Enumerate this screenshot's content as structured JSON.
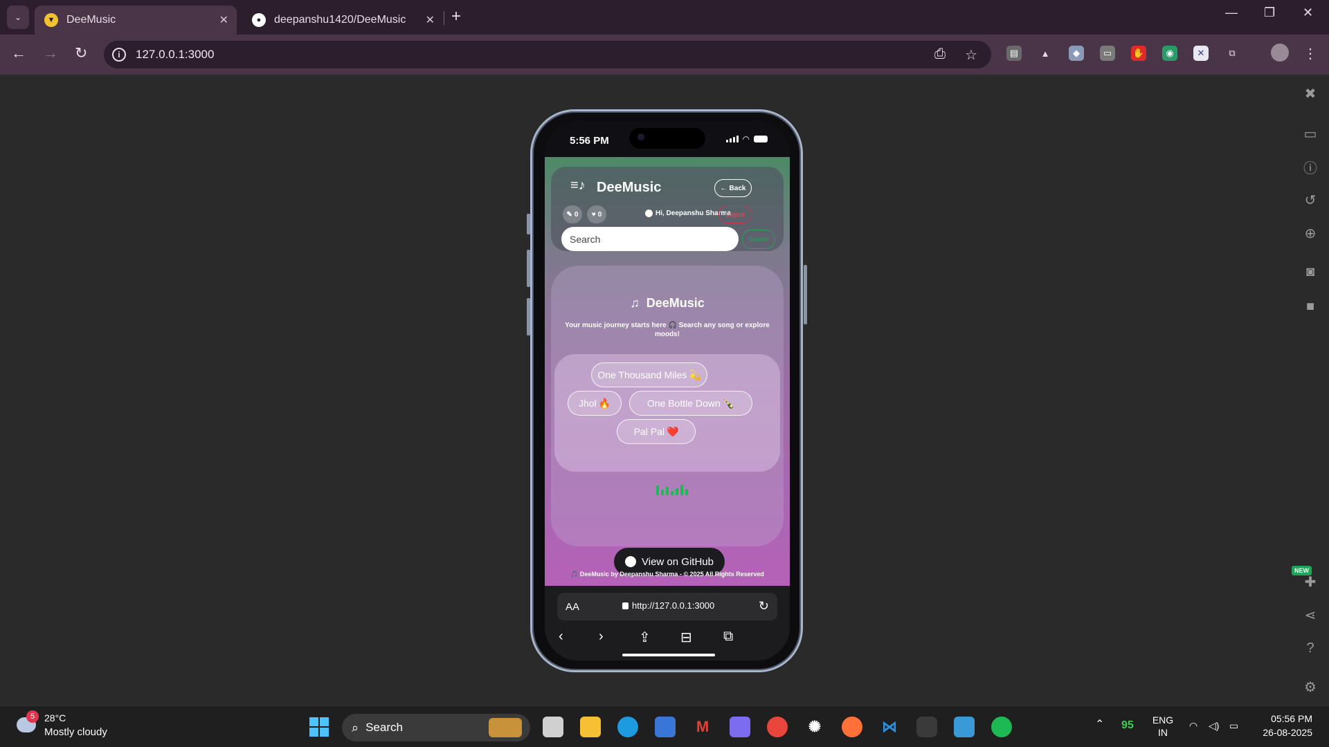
{
  "browser": {
    "tabs": [
      {
        "label": "DeeMusic",
        "active": true
      },
      {
        "label": "deepanshu1420/DeeMusic",
        "active": false
      }
    ],
    "url": "127.0.0.1:3000"
  },
  "phone": {
    "status_time": "5:56 PM",
    "app": {
      "brand": "DeeMusic",
      "back_label": "Back",
      "playlist_count": "0",
      "liked_count": "0",
      "greeting": "Hi, Deepanshu Sharma",
      "logout_label": "Logout",
      "search_placeholder": "Search",
      "search_button": "Search",
      "hero_title": "DeeMusic",
      "hero_subtitle": "Your music journey starts here 🎧 Search any song or explore moods!",
      "songs": [
        {
          "label": "One Thousand Miles",
          "emoji": "💫"
        },
        {
          "label": "Jhol",
          "emoji": "🔥"
        },
        {
          "label": "One Bottle Down",
          "emoji": "🍾"
        },
        {
          "label": "Pal Pal",
          "emoji": "❤️"
        }
      ],
      "github_label": "View on GitHub",
      "footer": "🎵 DeeMusic by Deepanshu Sharma - © 2025 All Rights Reserved"
    },
    "safari": {
      "aa_label": "AA",
      "url": "http://127.0.0.1:3000"
    }
  },
  "taskbar": {
    "weather_badge": "5",
    "temperature": "28°C",
    "condition": "Mostly cloudy",
    "search_label": "Search",
    "tray_number": "95",
    "lang_line1": "ENG",
    "lang_line2": "IN",
    "time": "05:56 PM",
    "date": "26-08-2025"
  },
  "colors": {
    "chrome_tab_bg": "#2d1e2e",
    "chrome_toolbar_bg": "#4a3548",
    "accent_green": "#1db954",
    "logout_red": "#c8374a"
  }
}
